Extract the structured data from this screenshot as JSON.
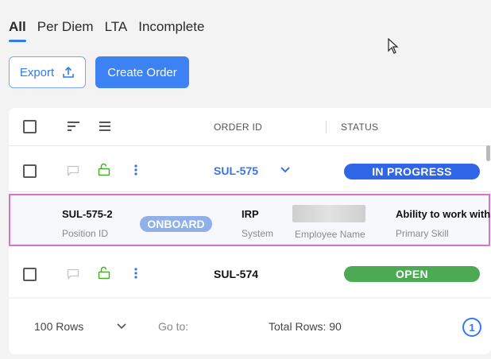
{
  "tabs": [
    "All",
    "Per Diem",
    "LTA",
    "Incomplete"
  ],
  "toolbar": {
    "export_label": "Export",
    "create_label": "Create Order"
  },
  "table": {
    "headers": {
      "order_id": "ORDER ID",
      "status": "STATUS"
    },
    "rows": [
      {
        "order_id": "SUL-575",
        "status": "IN PROGRESS",
        "status_color": "#2f66e6",
        "expanded": true
      },
      {
        "order_id": "SUL-574",
        "status": "OPEN",
        "status_color": "#4caa55",
        "expanded": false
      }
    ],
    "detail": {
      "position_id": "SUL-575-2",
      "position_id_label": "Position ID",
      "badge": "ONBOARD",
      "system": "IRP",
      "system_label": "System",
      "employee_name_label": "Employee Name",
      "primary_skill": "Ability to work with",
      "primary_skill_label": "Primary Skill"
    }
  },
  "footer": {
    "rows_select": "100 Rows",
    "goto_label": "Go to:",
    "total_rows": "Total Rows: 90",
    "page": "1"
  },
  "colors": {
    "accent": "#3478f6",
    "highlight_border": "#d770d1",
    "in_progress": "#2f66e6",
    "open": "#4caa55",
    "lock_icon": "#4caa2a"
  },
  "icons": [
    "upload-icon",
    "sort-icon",
    "menu-icon",
    "comment-icon",
    "unlock-icon",
    "more-vertical-icon",
    "chevron-down-icon",
    "cursor-icon"
  ]
}
